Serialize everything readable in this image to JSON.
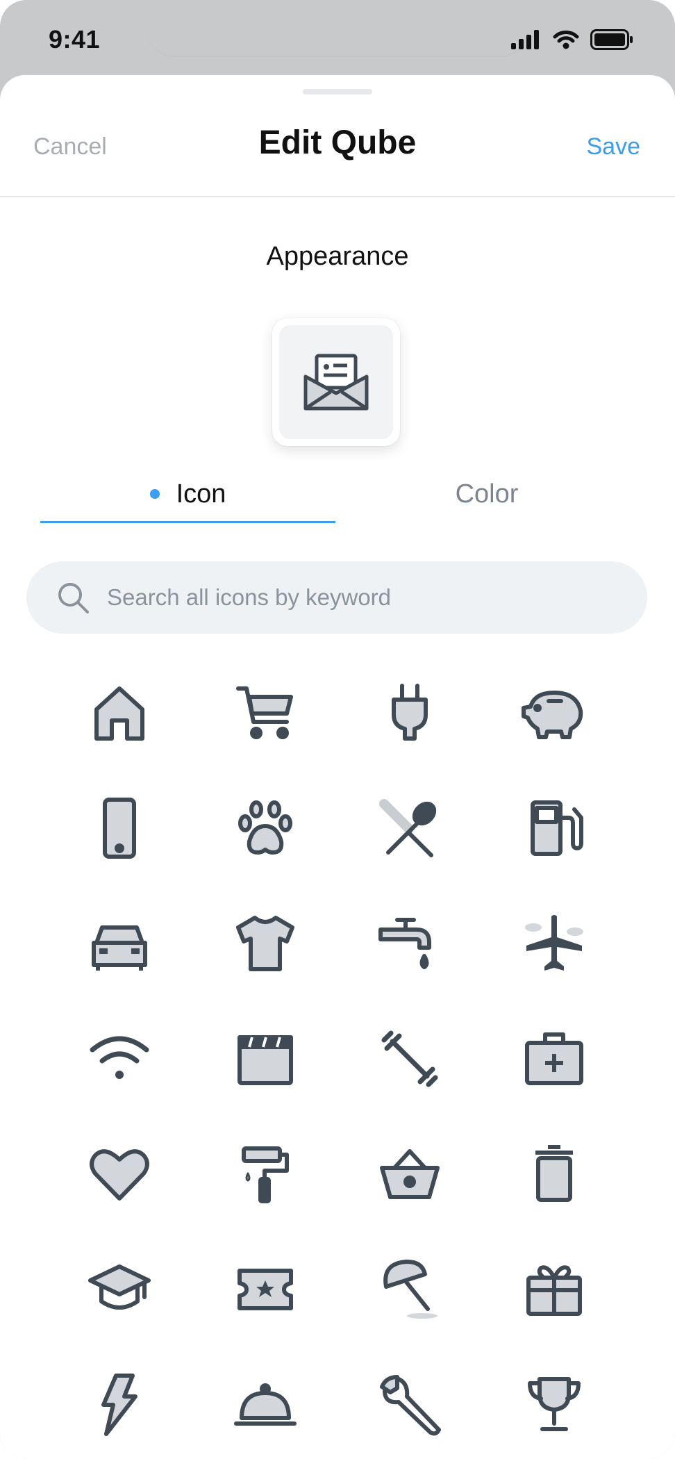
{
  "status_bar": {
    "time": "9:41"
  },
  "header": {
    "cancel_label": "Cancel",
    "title": "Edit Qube",
    "save_label": "Save"
  },
  "appearance": {
    "heading": "Appearance",
    "preview_icon": "envelope-card-icon"
  },
  "tabs": [
    {
      "label": "Icon",
      "active": true
    },
    {
      "label": "Color",
      "active": false
    }
  ],
  "search": {
    "placeholder": "Search all icons by keyword",
    "value": ""
  },
  "icon_grid": [
    "home-icon",
    "shopping-cart-icon",
    "plug-icon",
    "piggy-bank-icon",
    "smartphone-icon",
    "paw-icon",
    "fork-spoon-icon",
    "fuel-pump-icon",
    "car-icon",
    "tshirt-icon",
    "faucet-icon",
    "airplane-icon",
    "wifi-icon",
    "clapperboard-icon",
    "dumbbell-icon",
    "first-aid-kit-icon",
    "heart-icon",
    "paint-roller-icon",
    "basket-icon",
    "trash-icon",
    "graduation-cap-icon",
    "ticket-icon",
    "beach-umbrella-icon",
    "gift-icon",
    "lightning-icon",
    "cloche-icon",
    "wrench-icon",
    "trophy-icon"
  ],
  "colors": {
    "accent": "#3b9cf0",
    "icon_stroke": "#3f4a54",
    "icon_fill": "#d3d6da"
  }
}
